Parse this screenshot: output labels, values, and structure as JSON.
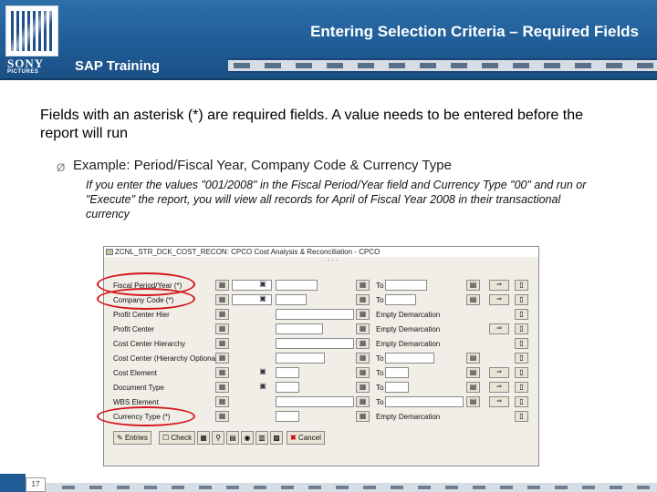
{
  "header": {
    "title": "Entering Selection Criteria – Required Fields",
    "brand": "SONY",
    "brand_sub": "PICTURES",
    "training": "SAP Training"
  },
  "content": {
    "intro": "Fields with an asterisk (*) are required fields.  A value needs to be entered before the report will run",
    "bullet_symbol": "Ø",
    "example": "Example: Period/Fiscal Year, Company Code & Currency Type",
    "detail": "If you enter the values \"001/2008\" in the Fiscal Period/Year field and Currency Type \"00\" and run or \"Execute\" the report, you will view all records for April of Fiscal Year 2008 in their transactional currency"
  },
  "sap": {
    "title": "ZCNL_STR_DCK_COST_RECON: CPCO Cost Analysis & Reconciliation - CPCO",
    "sep": "- - -",
    "to": "To",
    "empty_demarcation": "Empty Demarcation",
    "rows": [
      {
        "label": "Fiscal Period/Year (*)"
      },
      {
        "label": "Company Code (*)"
      },
      {
        "label": "Profit Center Hier"
      },
      {
        "label": "Profit Center"
      },
      {
        "label": "Cost Center Hierarchy"
      },
      {
        "label": "Cost Center (Hierarchy Optional)"
      },
      {
        "label": "Cost Element"
      },
      {
        "label": "Document Type"
      },
      {
        "label": "WBS Element"
      },
      {
        "label": "Currency Type (*)"
      }
    ],
    "toolbar": {
      "entries": "Entries",
      "check": "Check",
      "cancel": "Cancel"
    }
  },
  "footer": {
    "page_number": "17"
  },
  "colors": {
    "header_blue": "#1f5b95",
    "highlight_red": "#d4151c"
  }
}
